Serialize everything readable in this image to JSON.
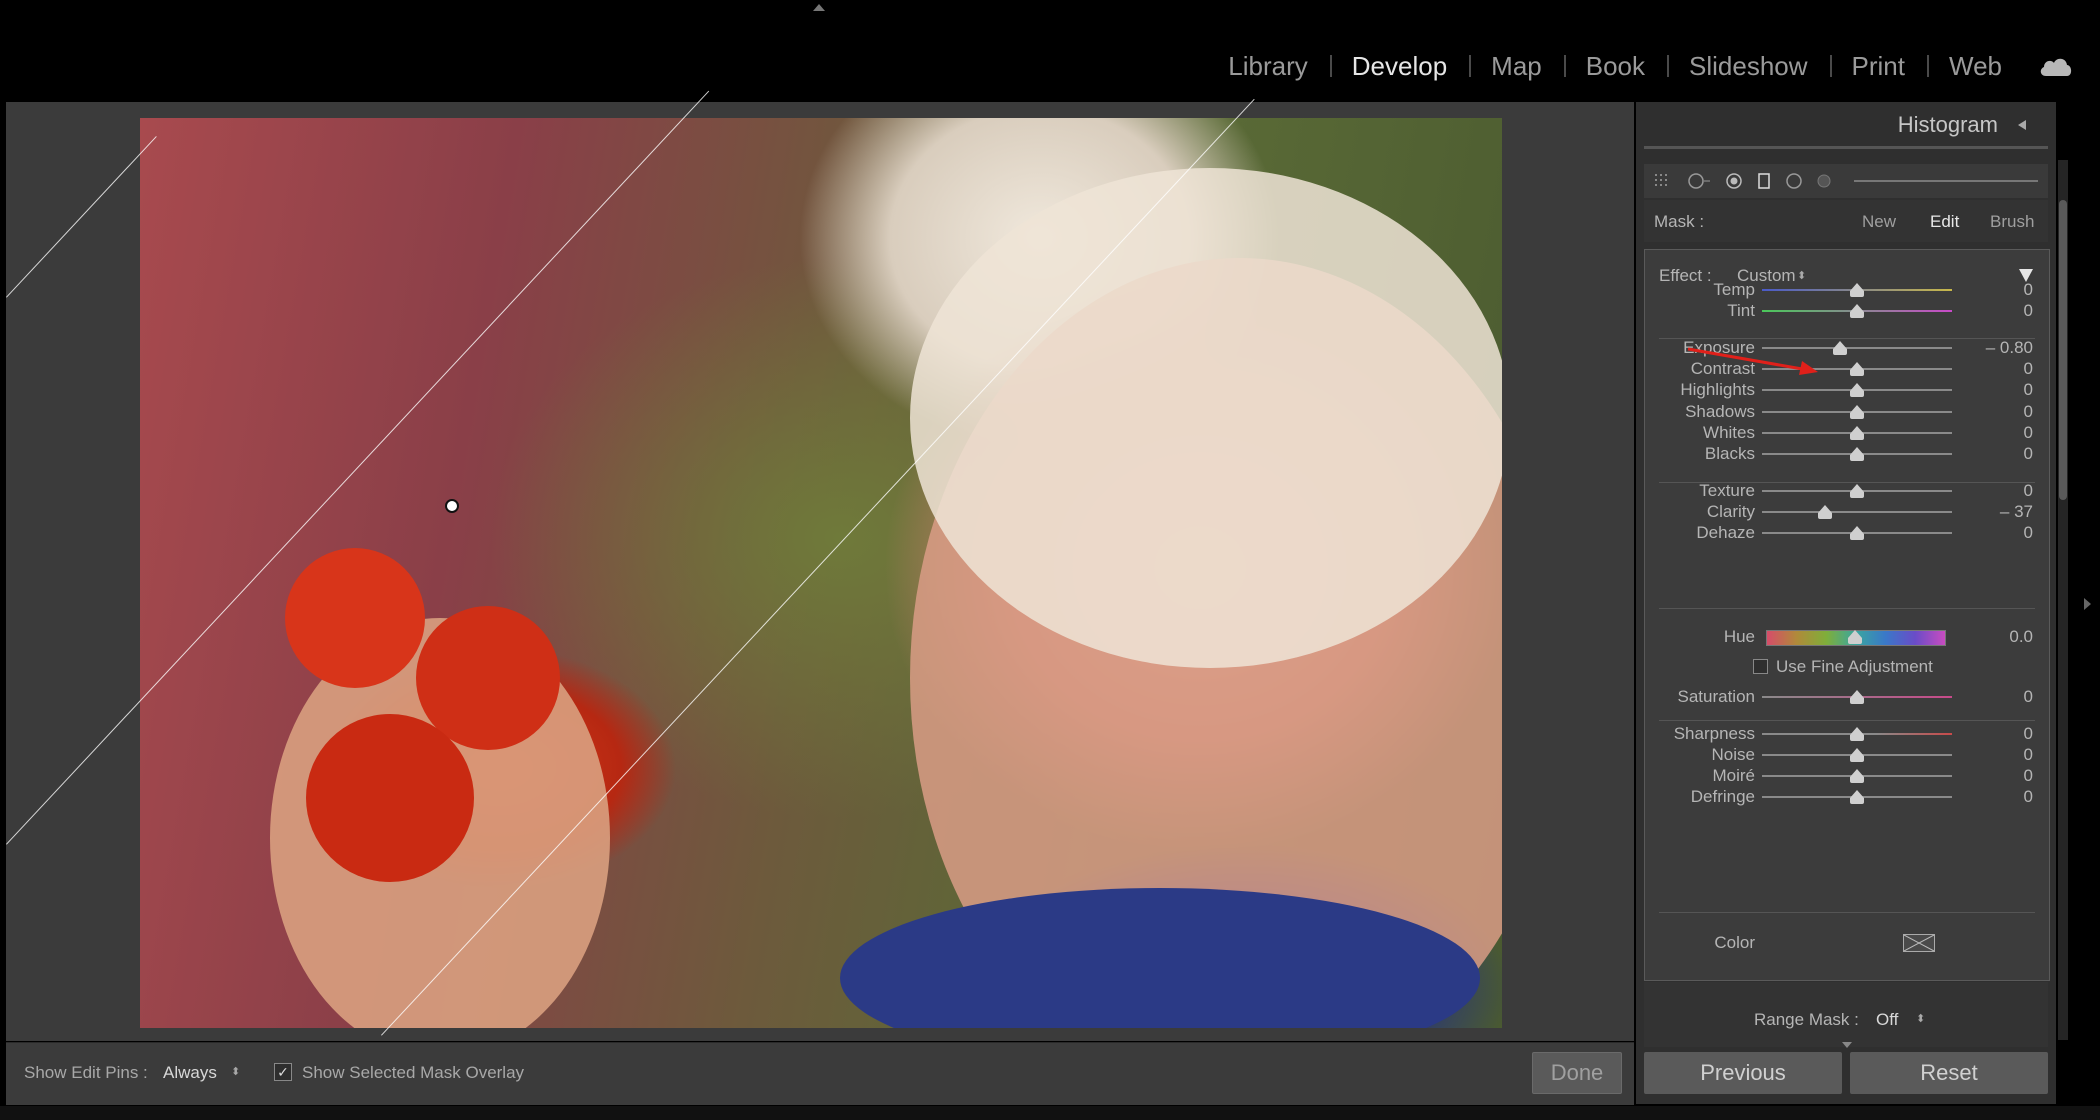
{
  "topbar": {
    "modules": [
      "Library",
      "Develop",
      "Map",
      "Book",
      "Slideshow",
      "Print",
      "Web"
    ],
    "active_module": "Develop",
    "cloud_icon": "cloud-icon"
  },
  "photo": {
    "alt": "Smiling older woman with white hair holding three red tomatoes"
  },
  "bottom_toolbar": {
    "show_pins_label": "Show Edit Pins :",
    "show_pins_value": "Always",
    "overlay_checked": true,
    "overlay_check_glyph": "✓",
    "overlay_label": "Show Selected Mask Overlay",
    "done_label": "Done"
  },
  "panel": {
    "histogram_title": "Histogram",
    "mask": {
      "label": "Mask :",
      "new": "New",
      "edit": "Edit",
      "brush": "Brush"
    },
    "effect": {
      "label": "Effect :",
      "value": "Custom"
    },
    "sliders": [
      {
        "id": "temp",
        "label": "Temp",
        "value": "0",
        "fraction": 0.5
      },
      {
        "id": "tint",
        "label": "Tint",
        "value": "0",
        "fraction": 0.5
      },
      {
        "id": "exposure",
        "label": "Exposure",
        "value": "– 0.80",
        "fraction": 0.41
      },
      {
        "id": "contrast",
        "label": "Contrast",
        "value": "0",
        "fraction": 0.5
      },
      {
        "id": "highlights",
        "label": "Highlights",
        "value": "0",
        "fraction": 0.5
      },
      {
        "id": "shadows",
        "label": "Shadows",
        "value": "0",
        "fraction": 0.5
      },
      {
        "id": "whites",
        "label": "Whites",
        "value": "0",
        "fraction": 0.5
      },
      {
        "id": "blacks",
        "label": "Blacks",
        "value": "0",
        "fraction": 0.5
      },
      {
        "id": "texture",
        "label": "Texture",
        "value": "0",
        "fraction": 0.5
      },
      {
        "id": "clarity",
        "label": "Clarity",
        "value": "– 37",
        "fraction": 0.33
      },
      {
        "id": "dehaze",
        "label": "Dehaze",
        "value": "0",
        "fraction": 0.5
      },
      {
        "id": "saturation",
        "label": "Saturation",
        "value": "0",
        "fraction": 0.5
      },
      {
        "id": "sharpness",
        "label": "Sharpness",
        "value": "0",
        "fraction": 0.5
      },
      {
        "id": "noise",
        "label": "Noise",
        "value": "0",
        "fraction": 0.5
      },
      {
        "id": "moire",
        "label": "Moiré",
        "value": "0",
        "fraction": 0.5
      },
      {
        "id": "defringe",
        "label": "Defringe",
        "value": "0",
        "fraction": 0.5
      }
    ],
    "hue": {
      "label": "Hue",
      "value": "0.0",
      "fraction": 0.5
    },
    "fine_adjust_label": "Use Fine Adjustment",
    "color_label": "Color",
    "range_mask": {
      "label": "Range Mask :",
      "value": "Off"
    },
    "previous_label": "Previous",
    "reset_label": "Reset"
  },
  "colors": {
    "background": "#000000",
    "panel": "#2f2f2f",
    "annotation_arrow": "#e0201a"
  }
}
